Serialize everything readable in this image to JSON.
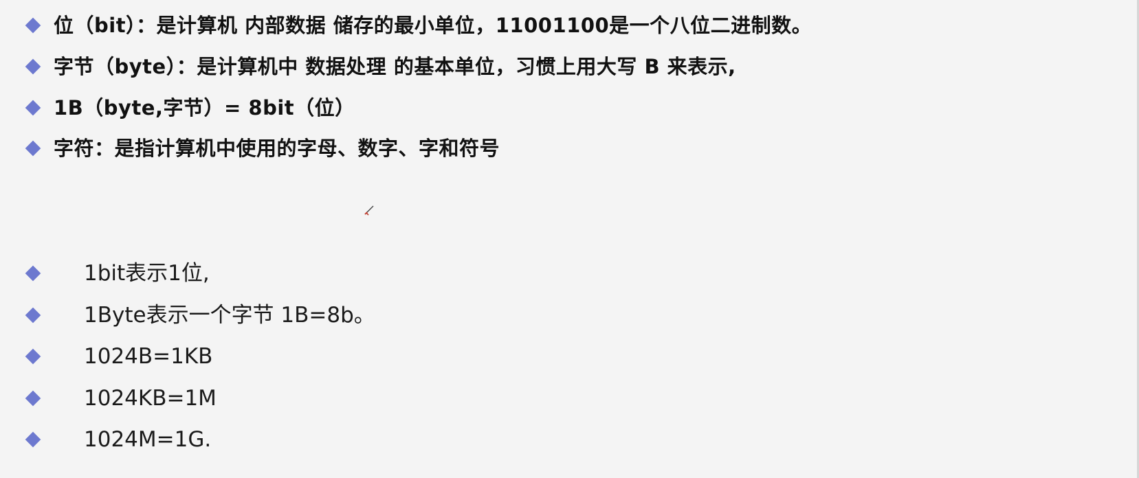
{
  "slide": {
    "bold_bullets": [
      {
        "text": "位（bit）：是计算机 内部数据 储存的最小单位，11001100是一个八位二进制数。"
      },
      {
        "text": "字节（byte）：是计算机中 数据处理 的基本单位，习惯上用大写 B 来表示,"
      },
      {
        "text": "1B（byte,字节）= 8bit（位）"
      },
      {
        "text": "字符：是指计算机中使用的字母、数字、字和符号"
      }
    ],
    "plain_bullets": [
      {
        "text": "1bit表示1位,"
      },
      {
        "text": "1Byte表示一个字节 1B=8b。"
      },
      {
        "text": "1024B=1KB"
      },
      {
        "text": "1024KB=1M"
      },
      {
        "text": "1024M=1G."
      }
    ],
    "bullet_color": "#6d79cf",
    "cursor_icon": "pen-cursor-icon"
  }
}
